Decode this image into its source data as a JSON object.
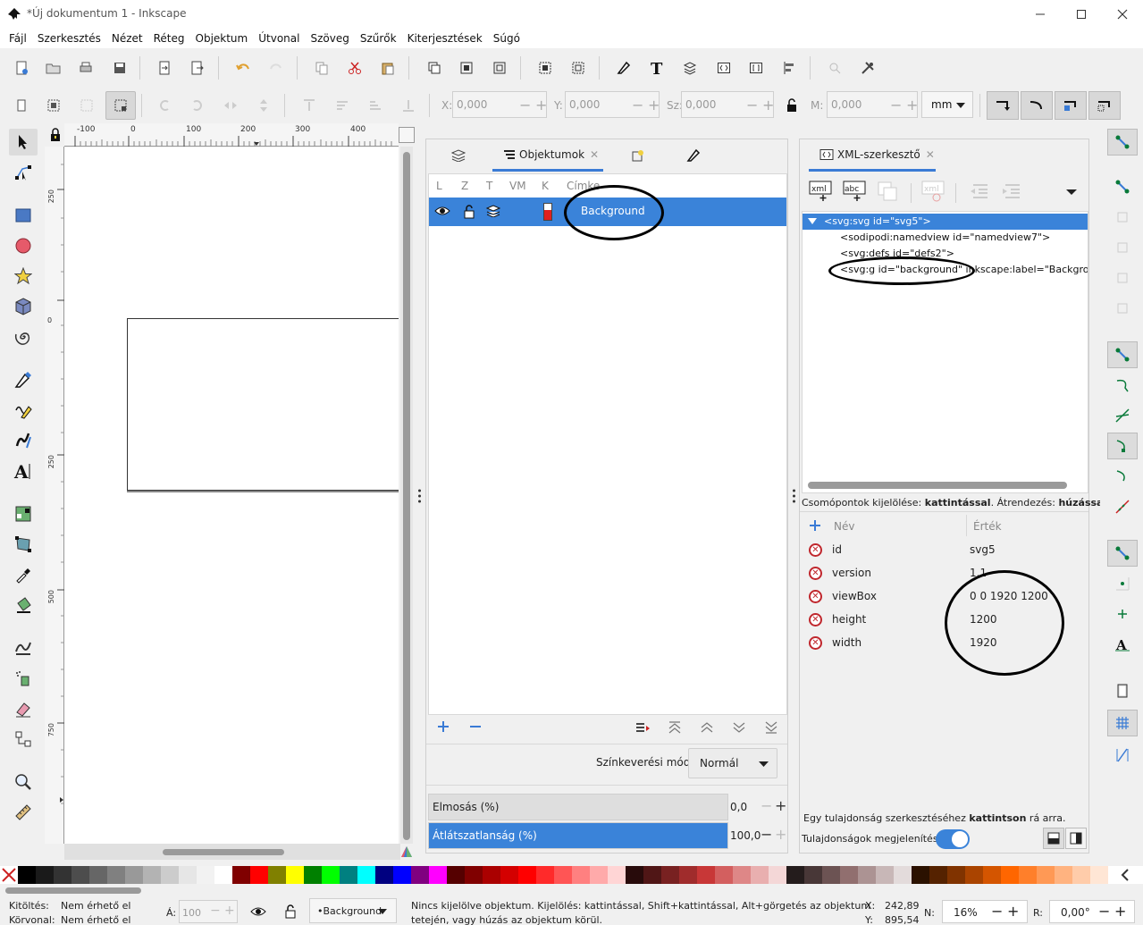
{
  "window": {
    "title": "*Új dokumentum 1 - Inkscape"
  },
  "menu": [
    "Fájl",
    "Szerkesztés",
    "Nézet",
    "Réteg",
    "Objektum",
    "Útvonal",
    "Szöveg",
    "Szűrők",
    "Kiterjesztések",
    "Súgó"
  ],
  "transform": {
    "x_label": "X:",
    "x_value": "0,000",
    "y_label": "Y:",
    "y_value": "0,000",
    "w_label": "Sz:",
    "w_value": "0,000",
    "h_label": "M:",
    "h_value": "0,000",
    "unit": "mm"
  },
  "ruler": {
    "top_ticks": [
      "-100",
      "0",
      "100",
      "200",
      "300",
      "400"
    ],
    "left_ticks": [
      "250",
      "0",
      "250",
      "500",
      "750"
    ]
  },
  "objects_panel": {
    "tab_label": "Objektumok",
    "columns": [
      "L",
      "Z",
      "T",
      "VM",
      "K",
      "Címke"
    ],
    "row_label": "Background",
    "blend_label": "Színkeverési mód:",
    "blend_value": "Normál",
    "blur_label": "Elmosás (%)",
    "blur_value": "0,0",
    "opacity_label": "Átlátszatlanság (%)",
    "opacity_value": "100,0",
    "opacity_fraction": 1.0
  },
  "xml_panel": {
    "tab_label": "XML-szerkesztő",
    "nodes": [
      "<svg:svg id=\"svg5\">",
      "<sodipodi:namedview id=\"namedview7\">",
      "<svg:defs id=\"defs2\">",
      "<svg:g id=\"background\" inkscape:label=\"Backgroun"
    ],
    "hint_prefix": "Csomópontok kijelölése: ",
    "hint_bold1": "kattintással",
    "hint_mid": ". Átrendezés: ",
    "hint_bold2": "húzással",
    "hint_end": ".",
    "attr_header_name": "Név",
    "attr_header_value": "Érték",
    "attributes": [
      {
        "name": "id",
        "value": "svg5"
      },
      {
        "name": "version",
        "value": "1.1"
      },
      {
        "name": "viewBox",
        "value": "0 0 1920 1200"
      },
      {
        "name": "height",
        "value": "1200"
      },
      {
        "name": "width",
        "value": "1920"
      }
    ],
    "edit_hint_prefix": "Egy tulajdonság szerkesztéséhez ",
    "edit_hint_bold": "kattintson",
    "edit_hint_end": " rá arra.",
    "show_attrs_label": "Tulajdonságok megjelenítése"
  },
  "status": {
    "fill_label": "Kitöltés:",
    "fill_value": "Nem érhető el",
    "stroke_label": "Körvonal:",
    "stroke_value": "Nem érhető el",
    "opacity_label": "Á:",
    "opacity_value": "100",
    "layer": "•Background",
    "message_line1": "Nincs kijelölve objektum. Kijelölés: kattintással, Shift+kattintással, Alt+görgetés az objektum",
    "message_line2": "tetején, vagy húzás az objektum körül.",
    "x_label": "X:",
    "x_value": "242,89",
    "y_label": "Y:",
    "y_value": "895,54",
    "zoom_label": "N:",
    "zoom_value": "16%",
    "rotate_label": "R:",
    "rotate_value": "0,00°"
  },
  "palette": [
    "#000000",
    "#1a1a1a",
    "#333333",
    "#4d4d4d",
    "#666666",
    "#808080",
    "#999999",
    "#b3b3b3",
    "#cccccc",
    "#e6e6e6",
    "#f2f2f2",
    "#ffffff",
    "#800000",
    "#ff0000",
    "#808000",
    "#ffff00",
    "#008000",
    "#00ff00",
    "#008080",
    "#00ffff",
    "#000080",
    "#0000ff",
    "#800080",
    "#ff00ff",
    "#550000",
    "#800000",
    "#aa0000",
    "#d40000",
    "#ff0000",
    "#ff2a2a",
    "#ff5555",
    "#ff8080",
    "#ffaaaa",
    "#ffd5d5",
    "#280b0b",
    "#501616",
    "#782121",
    "#a02c2c",
    "#c83737",
    "#d35f5f",
    "#de8787",
    "#e9afaf",
    "#f4d7d7",
    "#241c1c",
    "#483737",
    "#6c5353",
    "#916f6f",
    "#ac9393",
    "#c8b7b7",
    "#e3dbdb",
    "#2b1100",
    "#552200",
    "#803300",
    "#aa4400",
    "#d45500",
    "#ff6600",
    "#ff7f2a",
    "#ff9955",
    "#ffb380",
    "#ffccaa",
    "#ffe6d5"
  ]
}
